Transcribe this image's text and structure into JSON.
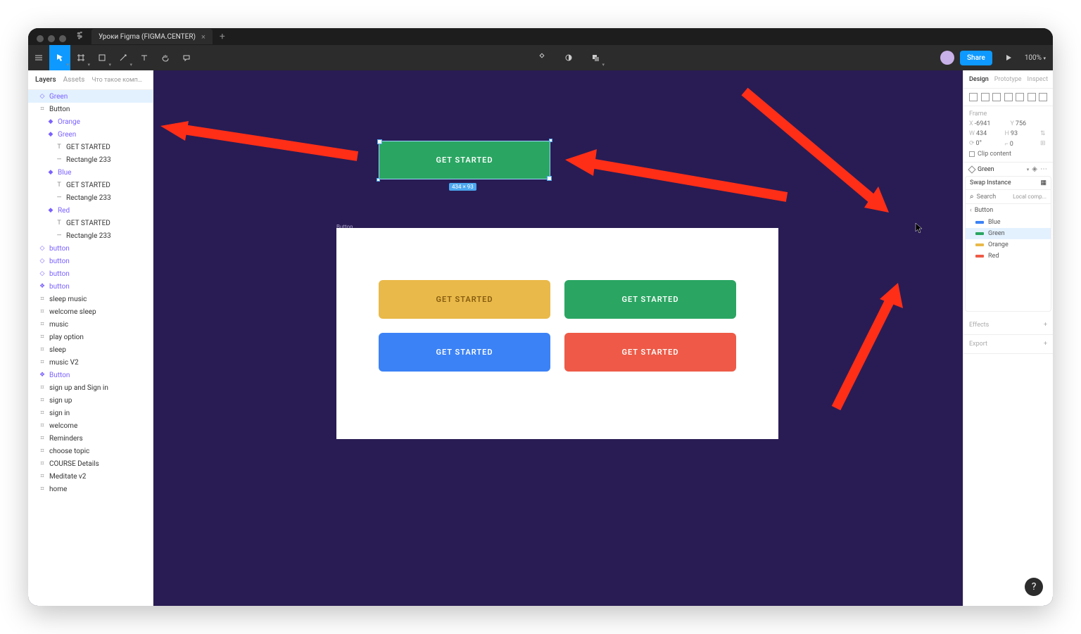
{
  "tab_title": "Уроки Figma (FIGMA.CENTER)",
  "toolbar": {
    "zoom": "100%",
    "share_label": "Share"
  },
  "left_panel": {
    "tabs": {
      "layers": "Layers",
      "assets": "Assets"
    },
    "page_name": "Что такое компоненты, как с...",
    "layers": [
      {
        "icon": "instance",
        "label": "Green",
        "depth": 0,
        "selected": true,
        "purple": true
      },
      {
        "icon": "frame",
        "label": "Button",
        "depth": 0
      },
      {
        "icon": "variant",
        "label": "Orange",
        "depth": 1,
        "purple": true
      },
      {
        "icon": "variant",
        "label": "Green",
        "depth": 1,
        "purple": true
      },
      {
        "icon": "text",
        "label": "GET STARTED",
        "depth": 2
      },
      {
        "icon": "rect",
        "label": "Rectangle 233",
        "depth": 2
      },
      {
        "icon": "variant",
        "label": "Blue",
        "depth": 1,
        "purple": true
      },
      {
        "icon": "text",
        "label": "GET STARTED",
        "depth": 2
      },
      {
        "icon": "rect",
        "label": "Rectangle 233",
        "depth": 2
      },
      {
        "icon": "variant",
        "label": "Red",
        "depth": 1,
        "purple": true
      },
      {
        "icon": "text",
        "label": "GET STARTED",
        "depth": 2
      },
      {
        "icon": "rect",
        "label": "Rectangle 233",
        "depth": 2
      },
      {
        "icon": "instance",
        "label": "button",
        "depth": 0,
        "purple": true
      },
      {
        "icon": "instance",
        "label": "button",
        "depth": 0,
        "purple": true
      },
      {
        "icon": "instance",
        "label": "button",
        "depth": 0,
        "purple": true
      },
      {
        "icon": "component",
        "label": "button",
        "depth": 0,
        "purple": true
      },
      {
        "icon": "frame",
        "label": "sleep music",
        "depth": 0
      },
      {
        "icon": "frame",
        "label": "welcome sleep",
        "depth": 0
      },
      {
        "icon": "frame",
        "label": "music",
        "depth": 0
      },
      {
        "icon": "frame",
        "label": "play option",
        "depth": 0
      },
      {
        "icon": "frame",
        "label": "sleep",
        "depth": 0
      },
      {
        "icon": "frame",
        "label": "music V2",
        "depth": 0
      },
      {
        "icon": "component",
        "label": "Button",
        "depth": 0,
        "purple": true
      },
      {
        "icon": "frame",
        "label": "sign up and Sign in",
        "depth": 0
      },
      {
        "icon": "frame",
        "label": "sign up",
        "depth": 0
      },
      {
        "icon": "frame",
        "label": "sign in",
        "depth": 0
      },
      {
        "icon": "frame",
        "label": "welcome",
        "depth": 0
      },
      {
        "icon": "frame",
        "label": "Reminders",
        "depth": 0
      },
      {
        "icon": "frame",
        "label": "choose topic",
        "depth": 0
      },
      {
        "icon": "frame",
        "label": "COURSE Details",
        "depth": 0
      },
      {
        "icon": "frame",
        "label": "Meditate v2",
        "depth": 0
      },
      {
        "icon": "frame",
        "label": "home",
        "depth": 0
      }
    ]
  },
  "canvas": {
    "selected_button_text": "GET STARTED",
    "dims_badge": "434 × 93",
    "frame_label": "Button",
    "buttons": [
      "GET STARTED",
      "GET STARTED",
      "GET STARTED",
      "GET STARTED"
    ]
  },
  "right_panel": {
    "tabs": {
      "design": "Design",
      "prototype": "Prototype",
      "inspect": "Inspect"
    },
    "frame_header": "Frame",
    "x": "-6941",
    "y": "756",
    "w": "434",
    "h": "93",
    "rot": "0°",
    "rad": "0",
    "clip_label": "Clip content",
    "instance_value": "Green",
    "swap": {
      "title": "Swap Instance",
      "search_placeholder": "Search",
      "local_label": "Local comp...",
      "crumb": "Button",
      "items": [
        {
          "label": "Blue",
          "color": "sw-blue"
        },
        {
          "label": "Green",
          "color": "sw-green",
          "selected": true
        },
        {
          "label": "Orange",
          "color": "sw-orange"
        },
        {
          "label": "Red",
          "color": "sw-red"
        }
      ]
    },
    "effects_label": "Effects",
    "export_label": "Export"
  }
}
